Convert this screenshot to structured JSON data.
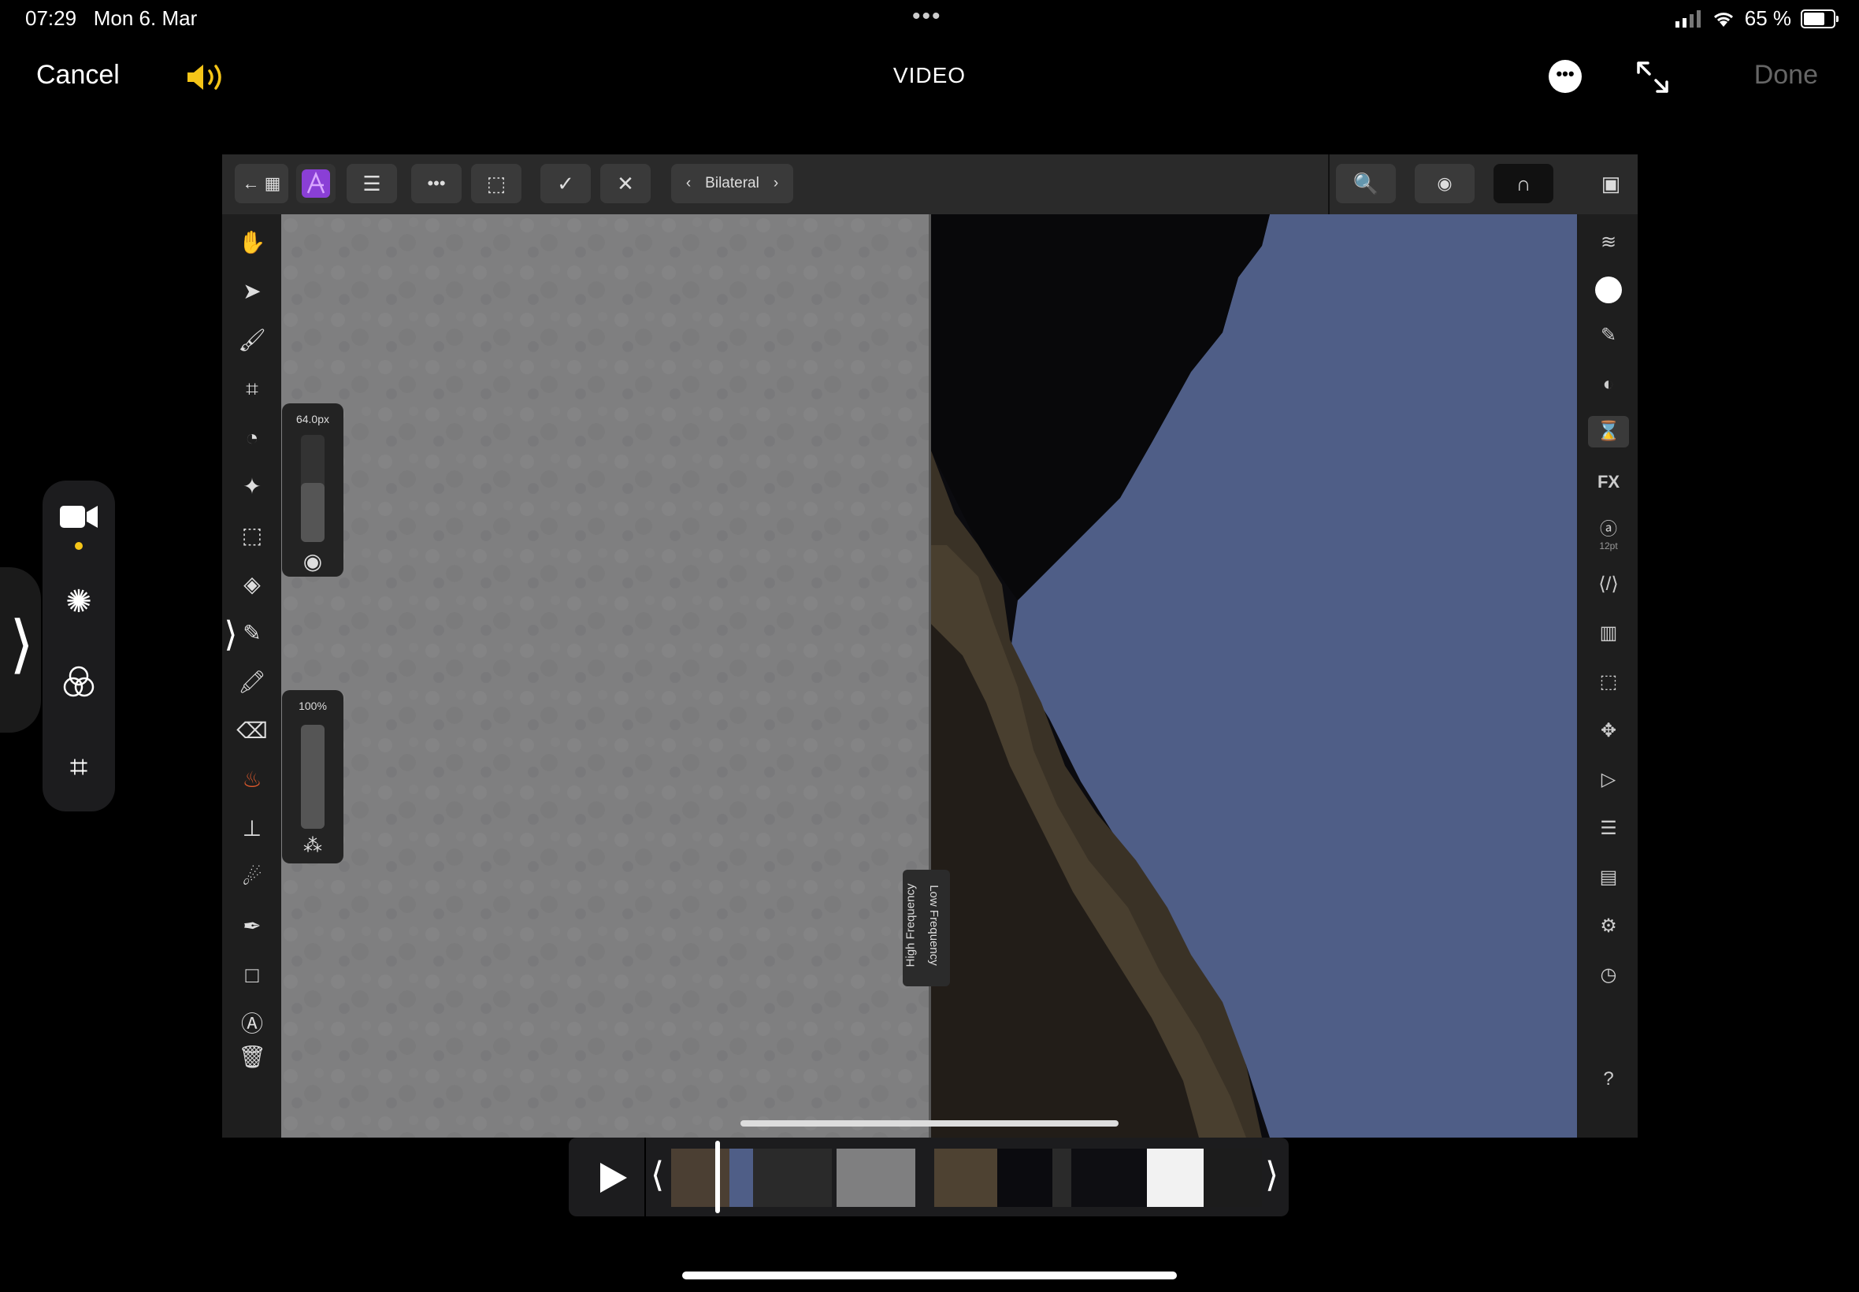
{
  "status_bar": {
    "time": "07:29",
    "date": "Mon 6. Mar",
    "battery": "65 %",
    "battery_level": 0.65
  },
  "nav": {
    "cancel": "Cancel",
    "title": "VIDEO",
    "done": "Done"
  },
  "toolbar": {
    "filter_name": "Bilateral"
  },
  "sliders": {
    "brush_size": "64.0px",
    "opacity": "100%",
    "brush_size_level": 0.55,
    "opacity_level": 1.0
  },
  "split_labels": {
    "high": "High Frequency",
    "low": "Low Frequency"
  },
  "right_panel": {
    "text_size": "12pt"
  },
  "colors": {
    "accent_volume": "#f5c518",
    "sky": "#4f5e87",
    "high_freq_gray": "#7f7f80"
  }
}
